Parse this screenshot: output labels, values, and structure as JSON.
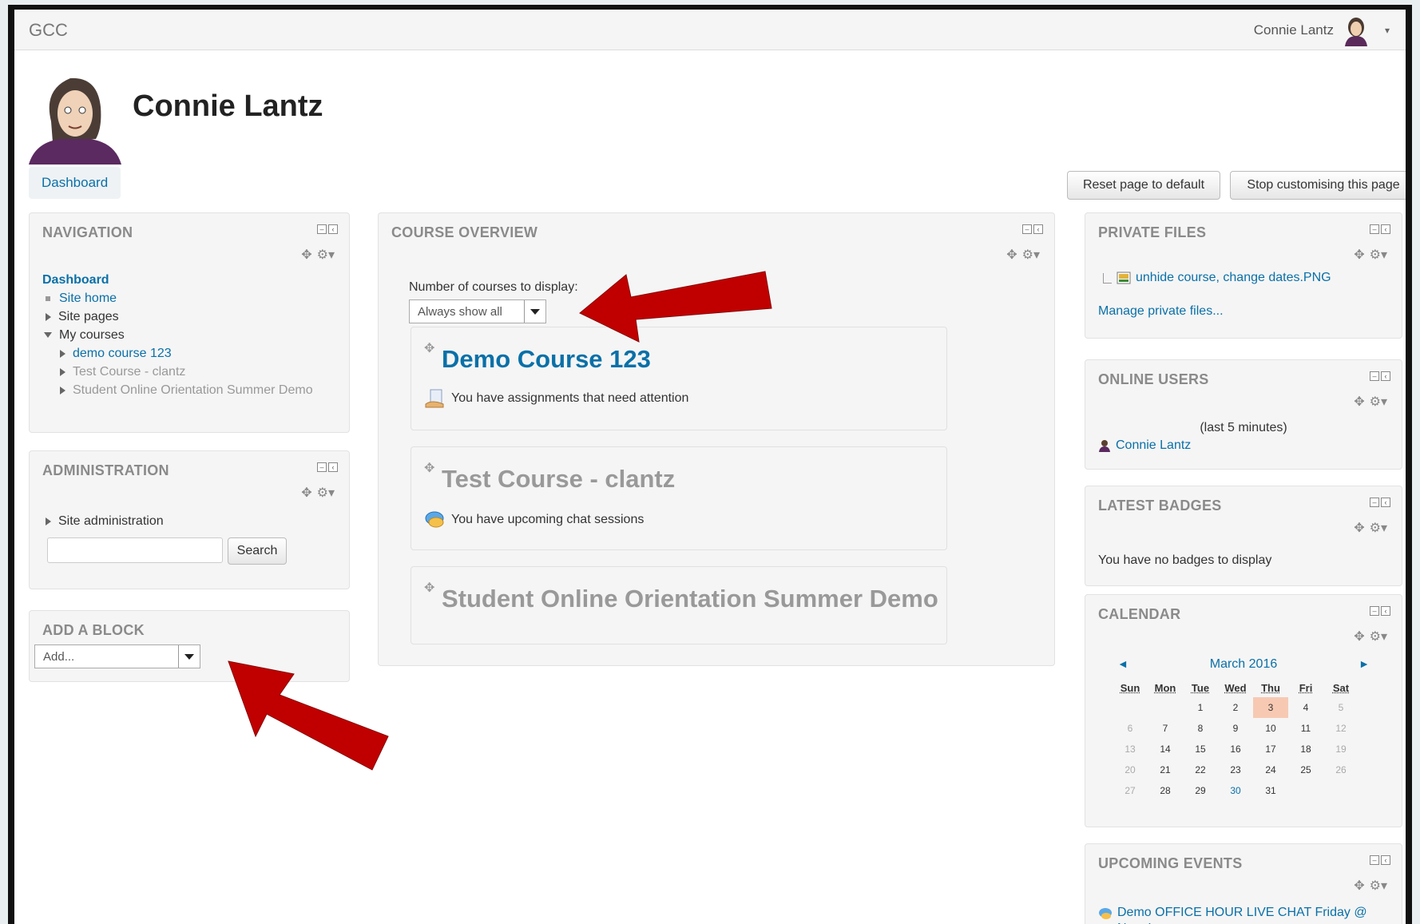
{
  "topbar": {
    "brand": "GCC",
    "user_name": "Connie Lantz"
  },
  "profile": {
    "name": "Connie Lantz"
  },
  "tabs": {
    "dashboard": "Dashboard"
  },
  "buttons": {
    "reset": "Reset page to default",
    "stop": "Stop customising this page"
  },
  "navigation": {
    "title": "NAVIGATION",
    "dashboard": "Dashboard",
    "site_home": "Site home",
    "site_pages": "Site pages",
    "my_courses": "My courses",
    "courses": [
      "demo course 123",
      "Test Course - clantz",
      "Student Online Orientation Summer Demo"
    ]
  },
  "administration": {
    "title": "ADMINISTRATION",
    "site_admin": "Site administration",
    "search_button": "Search"
  },
  "add_block": {
    "title": "ADD A BLOCK",
    "select_value": "Add..."
  },
  "course_overview": {
    "title": "COURSE OVERVIEW",
    "display_label": "Number of courses to display:",
    "display_value": "Always show all",
    "courses": [
      {
        "name": "Demo Course 123",
        "note": "You have assignments that need attention"
      },
      {
        "name": "Test Course - clantz",
        "note": "You have upcoming chat sessions"
      },
      {
        "name": "Student Online Orientation Summer Demo",
        "note": ""
      }
    ]
  },
  "private_files": {
    "title": "PRIVATE FILES",
    "file": "unhide course, change dates.PNG",
    "manage": "Manage private files..."
  },
  "online_users": {
    "title": "ONLINE USERS",
    "period": "(last 5 minutes)",
    "user": "Connie Lantz"
  },
  "latest_badges": {
    "title": "LATEST BADGES",
    "message": "You have no badges to display"
  },
  "calendar": {
    "title": "CALENDAR",
    "month": "March 2016",
    "prev": "◄",
    "next": "►",
    "days": [
      "Sun",
      "Mon",
      "Tue",
      "Wed",
      "Thu",
      "Fri",
      "Sat"
    ],
    "weeks": [
      [
        "",
        "",
        "1",
        "2",
        "3",
        "4",
        "5"
      ],
      [
        "6",
        "7",
        "8",
        "9",
        "10",
        "11",
        "12"
      ],
      [
        "13",
        "14",
        "15",
        "16",
        "17",
        "18",
        "19"
      ],
      [
        "20",
        "21",
        "22",
        "23",
        "24",
        "25",
        "26"
      ],
      [
        "27",
        "28",
        "29",
        "30",
        "31",
        "",
        ""
      ]
    ],
    "today": "3",
    "event_days": [
      "30"
    ]
  },
  "upcoming_events": {
    "title": "UPCOMING EVENTS",
    "event": "Demo OFFICE HOUR LIVE CHAT Friday @ Noon!"
  },
  "colors": {
    "link": "#0a70a8",
    "arrow": "#c00000",
    "today": "#f7c9b3"
  }
}
